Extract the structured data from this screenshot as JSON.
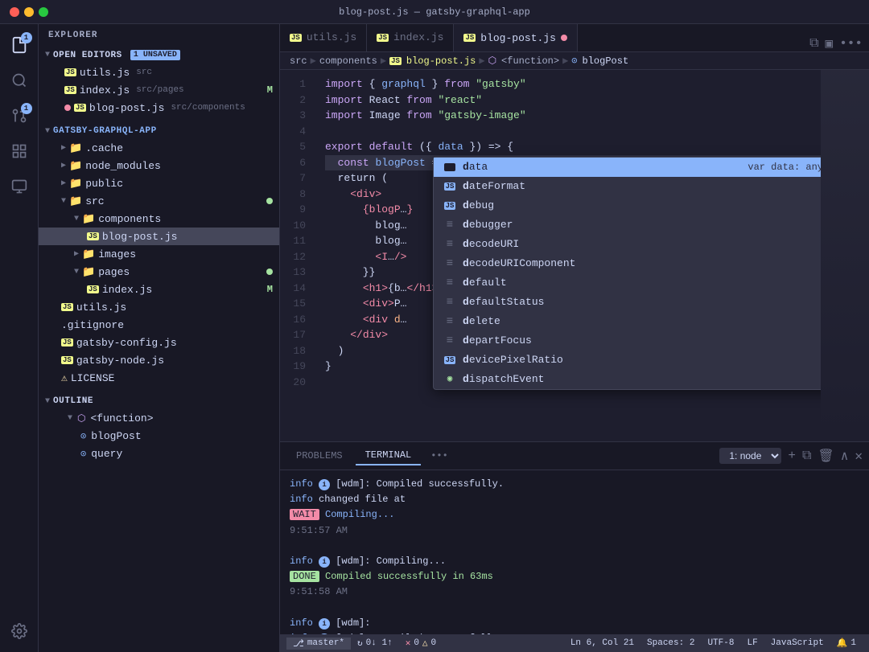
{
  "titlebar": {
    "title": "blog-post.js — gatsby-graphql-app",
    "icon": "JS"
  },
  "tabs": [
    {
      "id": "utils",
      "label": "utils.js",
      "icon": "JS",
      "active": false,
      "modified": false
    },
    {
      "id": "index",
      "label": "index.js",
      "icon": "JS",
      "active": false,
      "modified": false
    },
    {
      "id": "blog-post",
      "label": "blog-post.js",
      "icon": "JS",
      "active": true,
      "modified": true
    }
  ],
  "breadcrumb": {
    "items": [
      "src",
      "components",
      "blog-post.js",
      "<function>",
      "blogPost"
    ]
  },
  "sidebar": {
    "title": "EXPLORER",
    "open_editors": {
      "label": "OPEN EDITORS",
      "badge": "1 UNSAVED",
      "files": [
        {
          "name": "utils.js",
          "path": "src",
          "icon": "JS"
        },
        {
          "name": "index.js",
          "path": "src/pages",
          "icon": "JS",
          "modified": "M"
        },
        {
          "name": "blog-post.js",
          "path": "src/components",
          "icon": "JS",
          "dot": true
        }
      ]
    },
    "project": {
      "label": "GATSBY-GRAPHQL-APP",
      "folders": [
        {
          "name": ".cache",
          "indent": 1
        },
        {
          "name": "node_modules",
          "indent": 1
        },
        {
          "name": "public",
          "indent": 1
        },
        {
          "name": "src",
          "indent": 1,
          "expanded": true,
          "dot": true
        },
        {
          "name": "components",
          "indent": 2,
          "expanded": true
        },
        {
          "name": "blog-post.js",
          "indent": 3,
          "icon": "JS",
          "active": true
        },
        {
          "name": "images",
          "indent": 2
        },
        {
          "name": "pages",
          "indent": 2,
          "dot": true
        },
        {
          "name": "index.js",
          "indent": 3,
          "icon": "JS",
          "modified": "M"
        },
        {
          "name": "utils.js",
          "indent": 1,
          "icon": "JS"
        },
        {
          "name": ".gitignore",
          "indent": 1
        },
        {
          "name": "gatsby-config.js",
          "indent": 1,
          "icon": "JS"
        },
        {
          "name": "gatsby-node.js",
          "indent": 1,
          "icon": "JS"
        },
        {
          "name": "LICENSE",
          "indent": 1,
          "special": true
        }
      ]
    },
    "outline": {
      "label": "OUTLINE",
      "items": [
        {
          "name": "<function>",
          "type": "function",
          "indent": 1
        },
        {
          "name": "blogPost",
          "type": "object",
          "indent": 2
        },
        {
          "name": "query",
          "type": "object",
          "indent": 2
        }
      ]
    }
  },
  "code": {
    "lines": [
      {
        "num": 1,
        "content": "import_graphql",
        "tokens": [
          {
            "t": "import_kw",
            "v": "import"
          },
          {
            "t": "punct",
            "v": " { "
          },
          {
            "t": "fn",
            "v": "graphql"
          },
          {
            "t": "punct",
            "v": " } "
          },
          {
            "t": "from_kw",
            "v": "from"
          },
          {
            "t": "str",
            "v": " \"gatsby\""
          }
        ]
      },
      {
        "num": 2,
        "content": "import_react",
        "tokens": [
          {
            "t": "import_kw",
            "v": "import"
          },
          {
            "t": "var",
            "v": " React"
          },
          {
            "t": "from_kw",
            "v": " from"
          },
          {
            "t": "str",
            "v": " \"react\""
          }
        ]
      },
      {
        "num": 3,
        "content": "import_image",
        "tokens": [
          {
            "t": "import_kw",
            "v": "import"
          },
          {
            "t": "var",
            "v": " Image"
          },
          {
            "t": "from_kw",
            "v": " from"
          },
          {
            "t": "str",
            "v": " \"gatsby-image\""
          }
        ]
      },
      {
        "num": 4,
        "content": ""
      },
      {
        "num": 5,
        "content": "export_default"
      },
      {
        "num": 6,
        "content": "const_blogPost",
        "highlighted": true
      },
      {
        "num": 7,
        "content": "return"
      },
      {
        "num": 8,
        "content": "div_open"
      },
      {
        "num": 9,
        "content": "blogp"
      },
      {
        "num": 10,
        "content": "blog_slug"
      },
      {
        "num": 11,
        "content": "blog_title"
      },
      {
        "num": 12,
        "content": "img_tag"
      },
      {
        "num": 13,
        "content": "close_paren"
      },
      {
        "num": 14,
        "content": "h1_tag"
      },
      {
        "num": 15,
        "content": "div_p"
      },
      {
        "num": 16,
        "content": "div_d"
      },
      {
        "num": 17,
        "content": "div_close"
      },
      {
        "num": 18,
        "content": "paren_close"
      },
      {
        "num": 19,
        "content": "brace_close"
      },
      {
        "num": 20,
        "content": ""
      }
    ]
  },
  "autocomplete": {
    "items": [
      {
        "icon": "square",
        "label": "data",
        "selected": true,
        "typeHint": "var data: any",
        "showInfo": true
      },
      {
        "icon": "square",
        "label": "dateFormat",
        "selected": false
      },
      {
        "icon": "square",
        "label": "debug",
        "selected": false
      },
      {
        "icon": "lines",
        "label": "debugger",
        "selected": false
      },
      {
        "icon": "lines",
        "label": "decodeURI",
        "selected": false
      },
      {
        "icon": "lines",
        "label": "decodeURIComponent",
        "selected": false
      },
      {
        "icon": "lines",
        "label": "default",
        "selected": false
      },
      {
        "icon": "lines",
        "label": "defaultStatus",
        "selected": false
      },
      {
        "icon": "lines",
        "label": "delete",
        "selected": false
      },
      {
        "icon": "lines",
        "label": "departFocus",
        "selected": false
      },
      {
        "icon": "square",
        "label": "devicePixelRatio",
        "selected": false
      },
      {
        "icon": "circle",
        "label": "dispatchEvent",
        "selected": false
      }
    ]
  },
  "terminal": {
    "tabs": [
      "PROBLEMS",
      "TERMINAL",
      "..."
    ],
    "active_tab": "TERMINAL",
    "node_select": "1: node",
    "output": [
      {
        "type": "info",
        "text": "i [wdm]: Compiled successfully."
      },
      {
        "type": "info",
        "text": "changed file at"
      },
      {
        "type": "wait",
        "label": "WAIT",
        "text": " Compiling..."
      },
      {
        "type": "time",
        "text": "9:51:57 AM"
      },
      {
        "type": "blank"
      },
      {
        "type": "info",
        "text": "i [wdm]: Compiling..."
      },
      {
        "type": "done",
        "label": "DONE",
        "text": " Compiled successfully in 63ms"
      },
      {
        "type": "time",
        "text": "9:51:58 AM"
      },
      {
        "type": "blank"
      },
      {
        "type": "info",
        "text": "i [wdm]:"
      },
      {
        "type": "info",
        "text": "i [wdm]: Compiled successfully."
      }
    ]
  },
  "statusbar": {
    "branch": "master*",
    "sync": "↻ 0↓ 1↑",
    "errors": "✕ 0 △ 0",
    "position": "Ln 6, Col 21",
    "spaces": "Spaces: 2",
    "encoding": "UTF-8",
    "line_ending": "LF",
    "language": "JavaScript",
    "notifications": "🔔 1"
  }
}
